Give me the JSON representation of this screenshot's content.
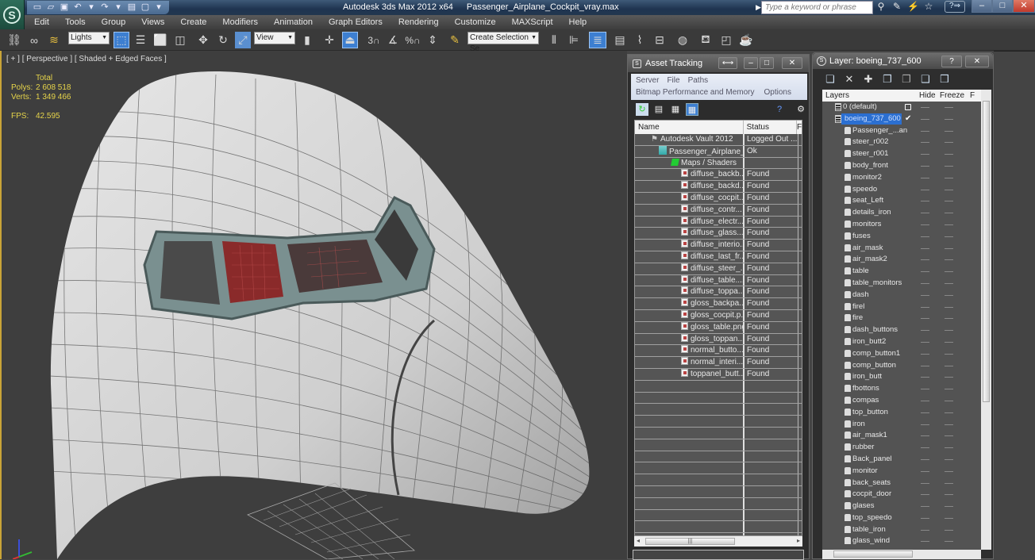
{
  "window": {
    "app_title": "Autodesk 3ds Max  2012 x64",
    "file_name": "Passenger_Airplane_Cockpit_vray.max",
    "search_placeholder": "Type a keyword or phrase",
    "controls": {
      "minimize": "–",
      "maximize": "□",
      "close": "✕"
    }
  },
  "menu": [
    "Edit",
    "Tools",
    "Group",
    "Views",
    "Create",
    "Modifiers",
    "Animation",
    "Graph Editors",
    "Rendering",
    "Customize",
    "MAXScript",
    "Help"
  ],
  "toolbar": {
    "selection_filter": "Lights",
    "reference_coord": "View",
    "named_selection": "Create Selection Se",
    "snap_toggle": "3",
    "percent_snap": "%"
  },
  "viewport": {
    "label": "[ + ] [ Perspective ] [ Shaded + Edged Faces ]",
    "stats": {
      "header": "Total",
      "polys_label": "Polys:",
      "polys": "2 608 518",
      "verts_label": "Verts:",
      "verts": "1 349 466",
      "fps_label": "FPS:",
      "fps": "42.595"
    }
  },
  "asset_tracking": {
    "title": "Asset Tracking",
    "menu_row1": [
      "Server",
      "File",
      "Paths"
    ],
    "menu_row2": [
      "Bitmap Performance and Memory",
      "Options"
    ],
    "columns": [
      "Name",
      "Status",
      "F"
    ],
    "rows": [
      {
        "name": "Autodesk Vault 2012",
        "status": "Logged Out ...",
        "type": "vault",
        "indent": 1
      },
      {
        "name": "Passenger_Airplane_...",
        "status": "Ok",
        "type": "max",
        "indent": 2
      },
      {
        "name": "Maps / Shaders",
        "status": "",
        "type": "maps",
        "indent": 3
      },
      {
        "name": "diffuse_backb...",
        "status": "Found",
        "type": "file",
        "indent": 4
      },
      {
        "name": "diffuse_backd...",
        "status": "Found",
        "type": "file",
        "indent": 4
      },
      {
        "name": "diffuse_cocpit...",
        "status": "Found",
        "type": "file",
        "indent": 4
      },
      {
        "name": "diffuse_contr...",
        "status": "Found",
        "type": "file",
        "indent": 4
      },
      {
        "name": "diffuse_electr...",
        "status": "Found",
        "type": "file",
        "indent": 4
      },
      {
        "name": "diffuse_glass....",
        "status": "Found",
        "type": "file",
        "indent": 4
      },
      {
        "name": "diffuse_interio...",
        "status": "Found",
        "type": "file",
        "indent": 4
      },
      {
        "name": "diffuse_last_fr...",
        "status": "Found",
        "type": "file",
        "indent": 4
      },
      {
        "name": "diffuse_steer_...",
        "status": "Found",
        "type": "file",
        "indent": 4
      },
      {
        "name": "diffuse_table....",
        "status": "Found",
        "type": "file",
        "indent": 4
      },
      {
        "name": "diffuse_toppa...",
        "status": "Found",
        "type": "file",
        "indent": 4
      },
      {
        "name": "gloss_backpa...",
        "status": "Found",
        "type": "file",
        "indent": 4
      },
      {
        "name": "gloss_cocpit.p...",
        "status": "Found",
        "type": "file",
        "indent": 4
      },
      {
        "name": "gloss_table.png",
        "status": "Found",
        "type": "file",
        "indent": 4
      },
      {
        "name": "gloss_toppan...",
        "status": "Found",
        "type": "file",
        "indent": 4
      },
      {
        "name": "normal_butto...",
        "status": "Found",
        "type": "file",
        "indent": 4
      },
      {
        "name": "normal_interi...",
        "status": "Found",
        "type": "file",
        "indent": 4
      },
      {
        "name": "toppanel_butt...",
        "status": "Found",
        "type": "file",
        "indent": 4
      }
    ],
    "empty_rows": 14
  },
  "layer_manager": {
    "title": "Layer: boeing_737_600",
    "title_buttons": {
      "help": "?",
      "close": "✕"
    },
    "columns": [
      "Layers",
      "Hide",
      "Freeze",
      "F"
    ],
    "layers": [
      {
        "name": "0 (default)",
        "kind": "layer"
      },
      {
        "name": "boeing_737_600",
        "kind": "layer",
        "selected": true,
        "current": true
      }
    ],
    "objects": [
      "Passenger_...an",
      "steer_r002",
      "steer_r001",
      "body_front",
      "monitor2",
      "speedo",
      "seat_Left",
      "details_iron",
      "monitors",
      "fuses",
      "air_mask",
      "air_mask2",
      "table",
      "table_monitors",
      "dash",
      "firel",
      "fire",
      "dash_buttons",
      "iron_butt2",
      "comp_button1",
      "comp_button",
      "iron_butt",
      "fbottons",
      "compas",
      "top_button",
      "iron",
      "air_mask1",
      "rubber",
      "Back_panel",
      "monitor",
      "back_seats",
      "cocpit_door",
      "glases",
      "top_speedo",
      "table_iron",
      "glass_wind"
    ]
  },
  "colors": {
    "accent": "#3d7fd1",
    "viewport_border": "#c9a437",
    "stats_text": "#e6d44a"
  }
}
